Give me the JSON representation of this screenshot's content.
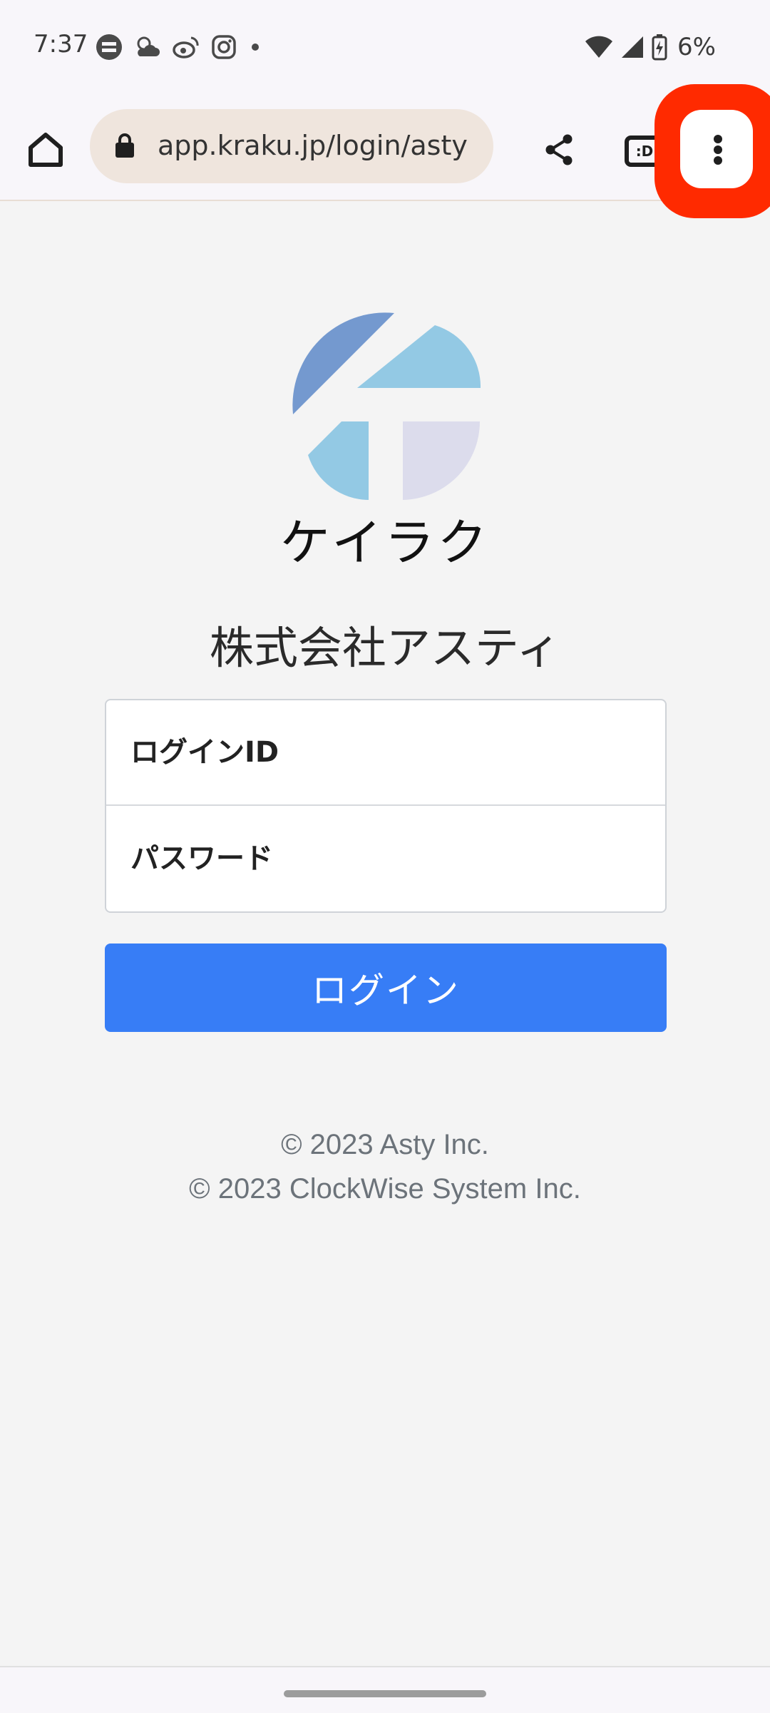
{
  "status_bar": {
    "time": "7:37",
    "battery_percent": "6%",
    "notification_icons": [
      "zozotown-icon",
      "weather-icon",
      "weibo-icon",
      "instagram-icon",
      "more-notifications-dot"
    ],
    "status_icons": [
      "wifi-icon",
      "cell-signal-icon",
      "battery-charging-icon"
    ]
  },
  "browser": {
    "url": "app.kraku.jp/login/asty",
    "tab_badge": ":D",
    "highlight_color": "#ff2a00"
  },
  "page": {
    "brand_name": "ケイラク",
    "company_name": "株式会社アスティ",
    "form": {
      "login_id_placeholder": "ログインID",
      "password_placeholder": "パスワード"
    },
    "login_button_label": "ログイン",
    "footer": {
      "line1": "© 2023 Asty Inc.",
      "line2": "© 2023 ClockWise System Inc."
    },
    "colors": {
      "primary_button": "#377df6",
      "logo_dark_blue": "#7499cf",
      "logo_light_blue": "#93c9e4",
      "logo_lavender": "#dcdcec"
    }
  }
}
